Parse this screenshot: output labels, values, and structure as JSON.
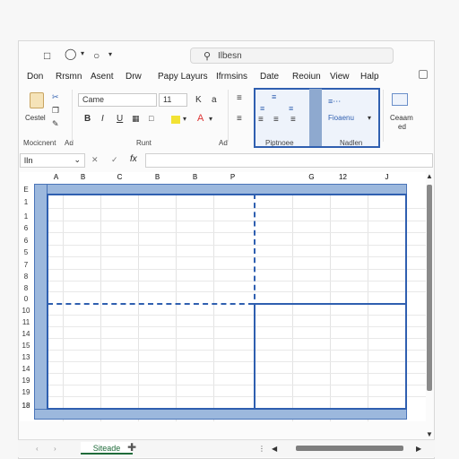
{
  "title_bar": {
    "search_placeholder": "Ilbesn",
    "icons": [
      "save-icon",
      "undo-icon",
      "redo-icon",
      "customize-icon"
    ]
  },
  "menu": {
    "items": [
      "Don",
      "Rrsmn",
      "Asent",
      "Drw",
      "Papy Layurs",
      "Ifrmsins",
      "Date",
      "Reoiun",
      "View",
      "Halp"
    ]
  },
  "ribbon": {
    "clipboard": {
      "paste_label": "Cestel",
      "group_label": "Mocicnent"
    },
    "clipboard_tail": "Ad",
    "font": {
      "name": "Came",
      "size": "11",
      "bold": "B",
      "italic": "I",
      "underline": "U",
      "group_label": "Runt",
      "grow": "K",
      "shrink": "a"
    },
    "alignment_group_label": "Ad",
    "highlight_group_label": "Piptnoee",
    "number_group_label": "Nadlen",
    "number_format_label": "Fioaenu",
    "cells": {
      "label": "Ceaam",
      "sub": "ed"
    }
  },
  "formula_bar": {
    "name_box": "lIn",
    "fx": "fx"
  },
  "grid": {
    "columns": [
      "A",
      "B",
      "C",
      "B",
      "B",
      "P",
      "",
      "G",
      "12",
      "J"
    ],
    "rows": [
      "E",
      "1",
      "1",
      "6",
      "6",
      "5",
      "7",
      "8",
      "8",
      "0",
      "10",
      "11",
      "14",
      "15",
      "13",
      "14",
      "19",
      "19",
      "18"
    ]
  },
  "sheet": {
    "tab_name": "Siteade",
    "add_icon": "plus-icon"
  },
  "colors": {
    "accent": "#2f5fb0",
    "selection": "#9cb8dd"
  }
}
